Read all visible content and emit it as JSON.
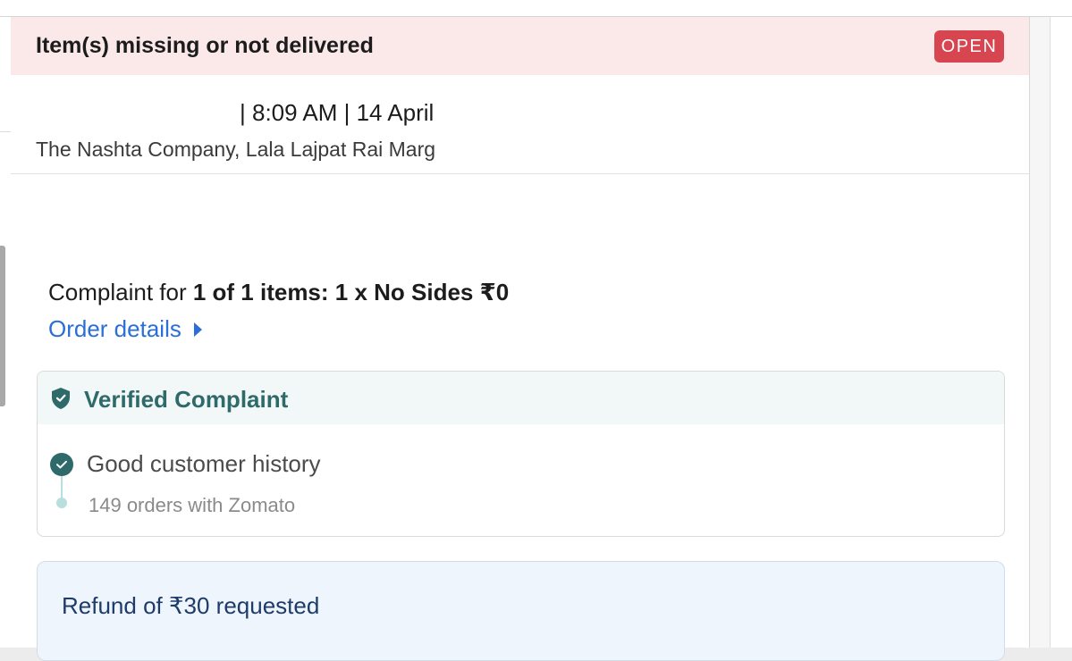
{
  "complaint": {
    "title": "Item(s) missing or not delivered",
    "status": "OPEN",
    "time_meta": "| 8:09 AM | 14 April",
    "restaurant": "The Nashta Company, Lala Lajpat Rai Marg",
    "complaint_prefix": "Complaint for ",
    "complaint_items": "1 of 1 items: 1 x No Sides ₹0",
    "order_details_link": "Order details",
    "verified": {
      "title": "Verified Complaint",
      "history_title": "Good customer history",
      "history_detail": "149 orders with Zomato"
    },
    "refund_text": "Refund of ₹30 requested"
  },
  "colors": {
    "header_bg": "#fbe9ea",
    "badge": "#d64550",
    "link": "#2b6ed8",
    "verified": "#2f6a6a",
    "refund_text": "#1d3b6b"
  },
  "icons": [
    "shield-check-icon",
    "check-circle-icon",
    "caret-right-icon"
  ]
}
